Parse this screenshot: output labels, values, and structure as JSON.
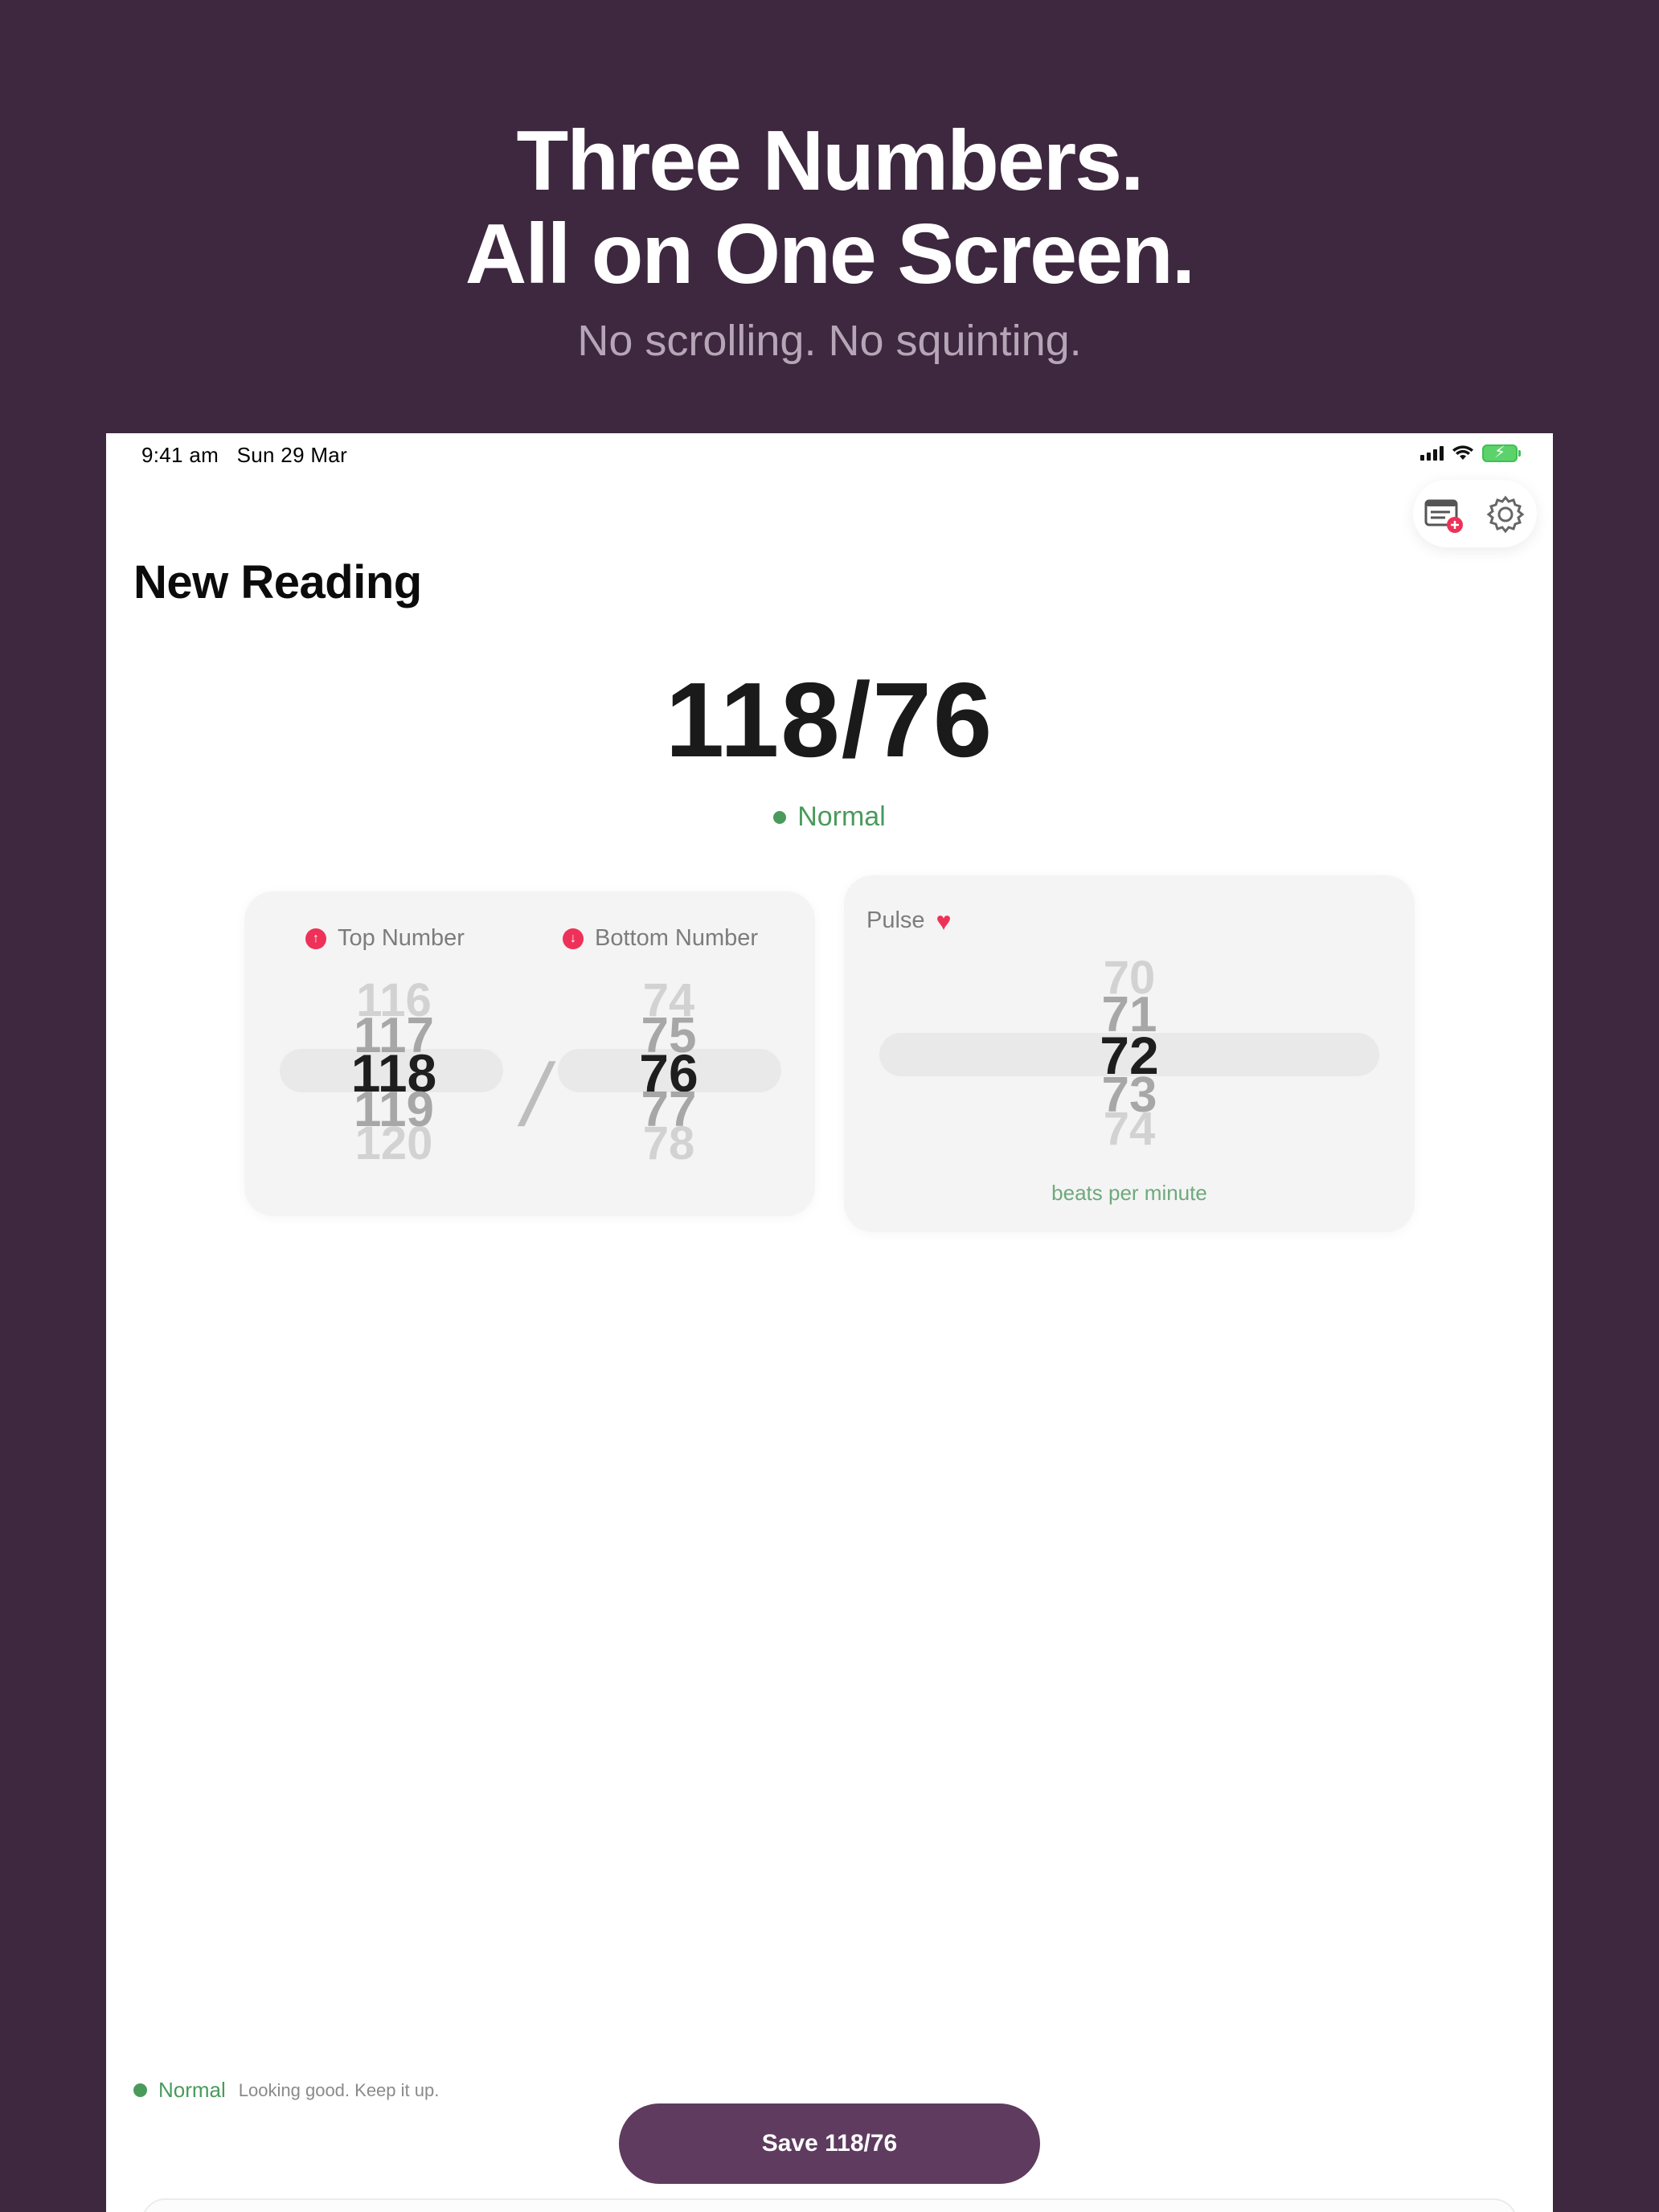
{
  "promo": {
    "title_line1": "Three Numbers.",
    "title_line2": "All on One Screen.",
    "subtitle": "No scrolling. No squinting."
  },
  "status_bar": {
    "time": "9:41 am",
    "date": "Sun 29 Mar"
  },
  "toolbar": {
    "list_icon": "reading-list-add-icon",
    "settings_icon": "gear-icon"
  },
  "page": {
    "title": "New Reading"
  },
  "reading": {
    "value": "118/76",
    "status": "Normal",
    "status_color": "#4a9a5c"
  },
  "bp_card": {
    "top_label": "Top Number",
    "bottom_label": "Bottom Number",
    "separator": "/",
    "top_wheel": [
      "116",
      "117",
      "118",
      "119",
      "120"
    ],
    "bottom_wheel": [
      "74",
      "75",
      "76",
      "77",
      "78"
    ]
  },
  "pulse_card": {
    "label": "Pulse",
    "heart_glyph": "♥",
    "wheel": [
      "70",
      "71",
      "72",
      "73",
      "74"
    ],
    "unit": "beats per minute"
  },
  "footer": {
    "status_label": "Normal",
    "status_hint": "Looking good. Keep it up.",
    "save_label": "Save 118/76"
  },
  "colors": {
    "background": "#3d283f",
    "accent": "#5e3b5f",
    "alert": "#ee3158",
    "normal": "#4a9a5c"
  }
}
